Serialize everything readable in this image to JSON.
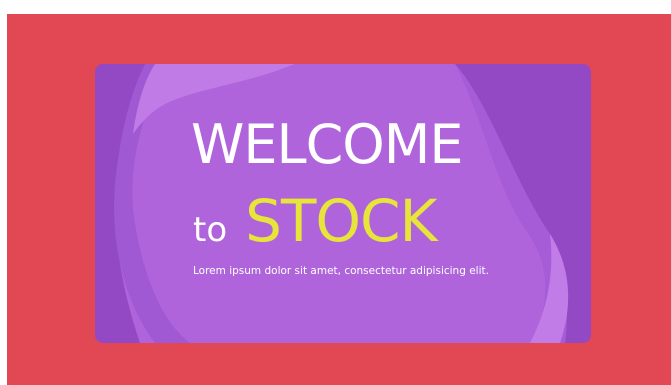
{
  "banner": {
    "heading_line1": "WELCOME",
    "heading_to": "to",
    "heading_highlight": "STOCK",
    "subtitle": "Lorem ipsum dolor sit amet, consectetur adipisicing elit."
  },
  "colors": {
    "outer_background": "#e24754",
    "card_base": "#9348c4",
    "blob_main": "#af62db",
    "blob_light": "#c07be6",
    "heading_text": "#ffffff",
    "highlight_text": "#e7e43a"
  }
}
